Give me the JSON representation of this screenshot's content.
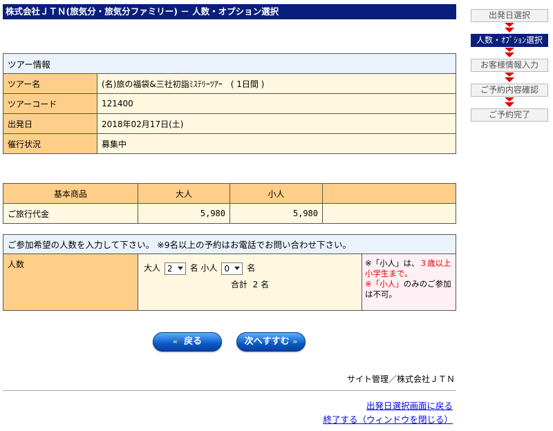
{
  "title": "株式会社ＪＴＮ(旅気分・旅気分ファミリー) － 人数・オプション選択",
  "steps": [
    {
      "label": "出発日選択",
      "active": false
    },
    {
      "label": "人数・ｵﾌﾟｼｮﾝ選択",
      "active": true
    },
    {
      "label": "お客様情報入力",
      "active": false
    },
    {
      "label": "ご予約内容確認",
      "active": false
    },
    {
      "label": "ご予約完了",
      "active": false
    }
  ],
  "tour": {
    "header": "ツアー情報",
    "rows": [
      {
        "label": "ツアー名",
        "value": "(名)旅の福袋&三社初詣ﾐｽﾃﾘｰﾂｱｰ　( 1日間 )"
      },
      {
        "label": "ツアーコード",
        "value": "121400"
      },
      {
        "label": "出発日",
        "value": "2018年02月17日(土)"
      },
      {
        "label": "催行状況",
        "value": "募集中"
      }
    ]
  },
  "price": {
    "headers": [
      "基本商品",
      "大人",
      "小人",
      ""
    ],
    "row": {
      "label": "ご旅行代金",
      "adult": "5,980",
      "child": "5,980"
    }
  },
  "people": {
    "header": "ご参加希望の人数を入力して下さい。 ※9名以上の予約はお電話でお問い合わせ下さい。",
    "label": "人数",
    "adult_label": "大人",
    "adult_value": "2",
    "child_label": "小人",
    "child_value": "0",
    "unit": "名",
    "total_label": "合計",
    "total_value": "2",
    "note_1a": "※「小人」は、",
    "note_1b": "３歳以上小学生まで。",
    "note_2a": "※「小人」",
    "note_2b": "のみのご参加は不可。"
  },
  "buttons": {
    "back": "戻る",
    "next": "次へすすむ",
    "back_chevron": "«",
    "next_chevron": "»"
  },
  "footer": {
    "admin": "サイト管理／株式会社ＪＴＮ",
    "link_back": "出発日選択画面に戻る",
    "link_close": "終了する（ウィンドウを閉じる）"
  },
  "colors": {
    "navy": "#0a1e7c",
    "label_orange": "#ffcf8a",
    "value_cream": "#fff7df",
    "header_blue": "#eaf3fb",
    "step_arrow": "#e00000"
  }
}
